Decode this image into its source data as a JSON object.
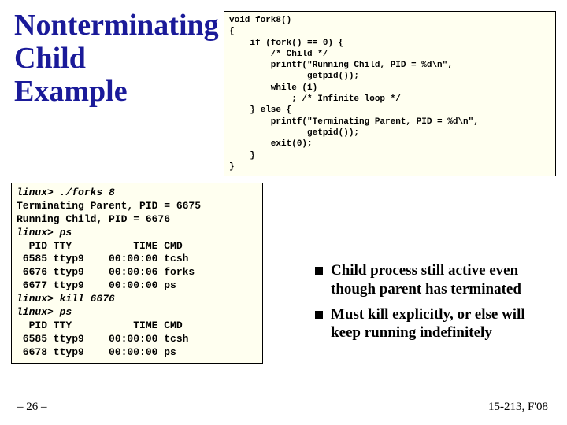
{
  "title_l1": "Nonterminating",
  "title_l2": "Child",
  "title_l3": "Example",
  "code": "void fork8()\n{\n    if (fork() == 0) {\n        /* Child */\n        printf(\"Running Child, PID = %d\\n\",\n               getpid());\n        while (1)\n            ; /* Infinite loop */\n    } else {\n        printf(\"Terminating Parent, PID = %d\\n\",\n               getpid());\n        exit(0);\n    }\n}",
  "term_lines": [
    {
      "italic": true,
      "text": "linux> ./forks 8"
    },
    {
      "italic": false,
      "text": "Terminating Parent, PID = 6675"
    },
    {
      "italic": false,
      "text": "Running Child, PID = 6676"
    },
    {
      "italic": true,
      "text": "linux> ps"
    },
    {
      "italic": false,
      "text": "  PID TTY          TIME CMD"
    },
    {
      "italic": false,
      "text": " 6585 ttyp9    00:00:00 tcsh"
    },
    {
      "italic": false,
      "text": " 6676 ttyp9    00:00:06 forks"
    },
    {
      "italic": false,
      "text": " 6677 ttyp9    00:00:00 ps"
    },
    {
      "italic": true,
      "text": "linux> kill 6676"
    },
    {
      "italic": true,
      "text": "linux> ps"
    },
    {
      "italic": false,
      "text": "  PID TTY          TIME CMD"
    },
    {
      "italic": false,
      "text": " 6585 ttyp9    00:00:00 tcsh"
    },
    {
      "italic": false,
      "text": " 6678 ttyp9    00:00:00 ps"
    }
  ],
  "bullets": [
    "Child process still active even though parent has terminated",
    "Must kill explicitly, or else will keep running indefinitely"
  ],
  "footer_left": "– 26 –",
  "footer_right": "15-213, F'08"
}
